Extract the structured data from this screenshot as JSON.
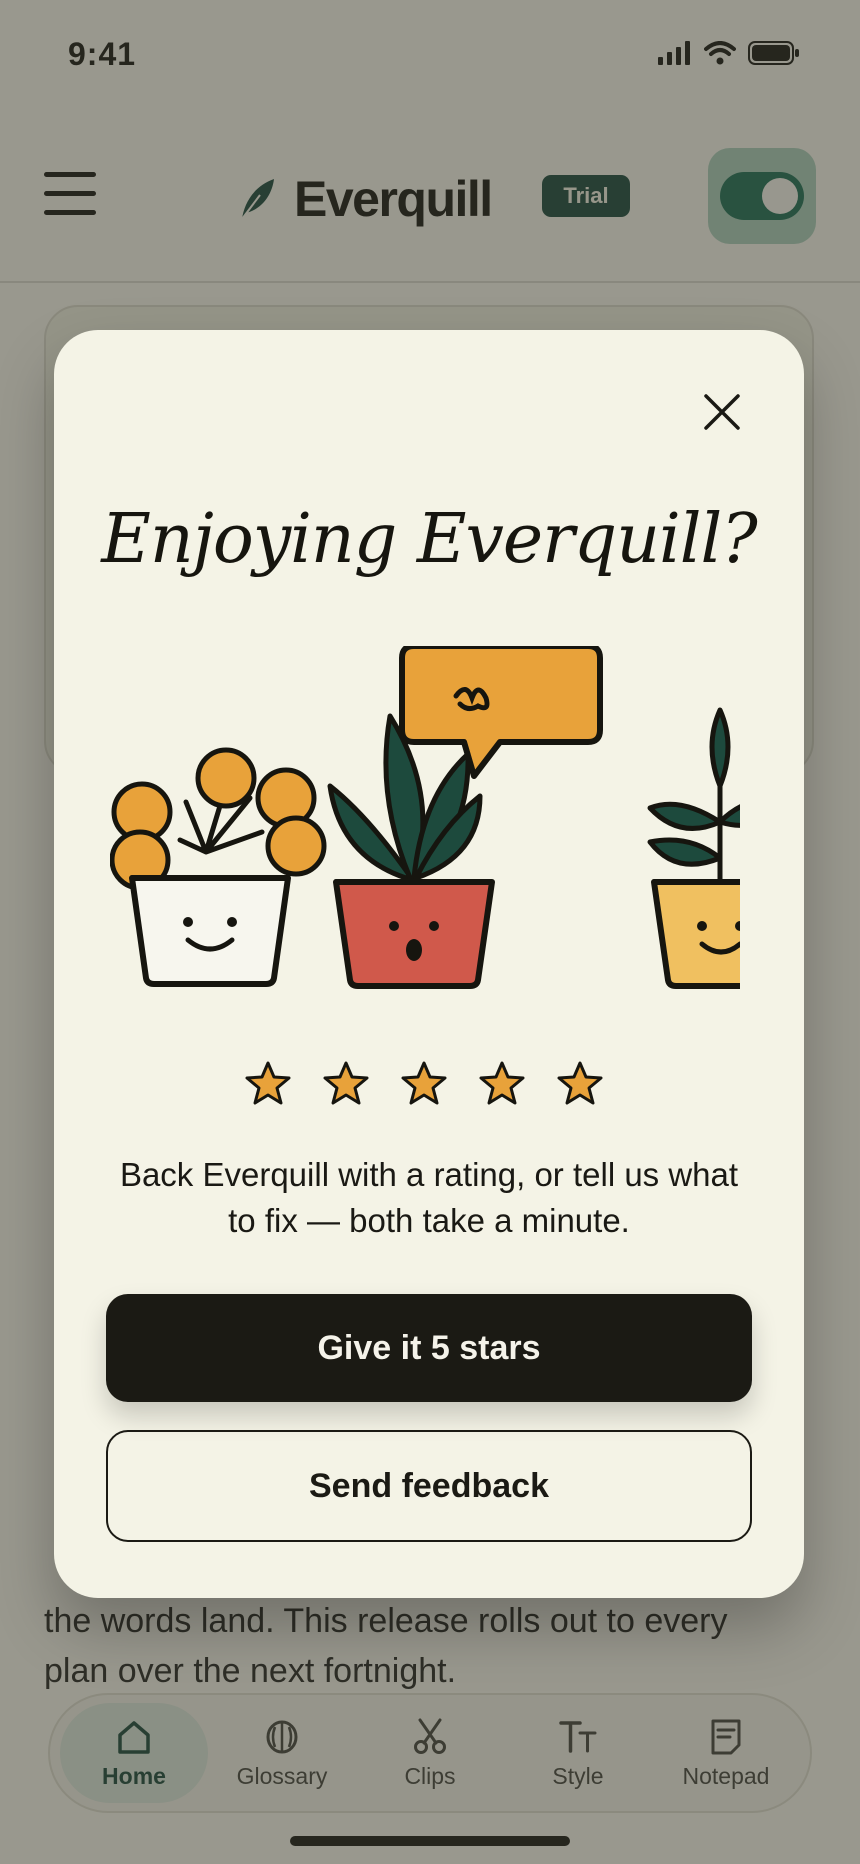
{
  "status_bar": {
    "time": "9:41",
    "icons": [
      "signal-icon",
      "wifi-icon",
      "battery-icon"
    ]
  },
  "header": {
    "app_name": "Everquill",
    "badge": "Trial",
    "menu_icon": "hamburger-icon",
    "logo_icon": "feather-icon",
    "toggle_state": "on"
  },
  "article": {
    "visible_tail_lines": [
      "the words land. This release rolls out to every",
      "plan over the next fortnight."
    ]
  },
  "modal": {
    "title": "Enjoying Everquill?",
    "body": "Back Everquill with a rating, or tell us what to fix — both take a minute.",
    "rating_stars": 5,
    "primary_button": "Give it 5 stars",
    "secondary_button": "Send feedback",
    "close_icon": "close-icon"
  },
  "tab_bar": {
    "tabs": [
      {
        "label": "Home",
        "icon": "home-icon",
        "active": true
      },
      {
        "label": "Glossary",
        "icon": "book-icon",
        "active": false
      },
      {
        "label": "Clips",
        "icon": "scissors-icon",
        "active": false
      },
      {
        "label": "Style",
        "icon": "text-style-icon",
        "active": false
      },
      {
        "label": "Notepad",
        "icon": "notepad-icon",
        "active": false
      }
    ]
  },
  "colors": {
    "accent": "#1f6e55",
    "badge_bg": "#1e4a3f",
    "star": "#e8a23a",
    "primary_button": "#1b1a14",
    "modal_bg": "#f4f3e6"
  }
}
